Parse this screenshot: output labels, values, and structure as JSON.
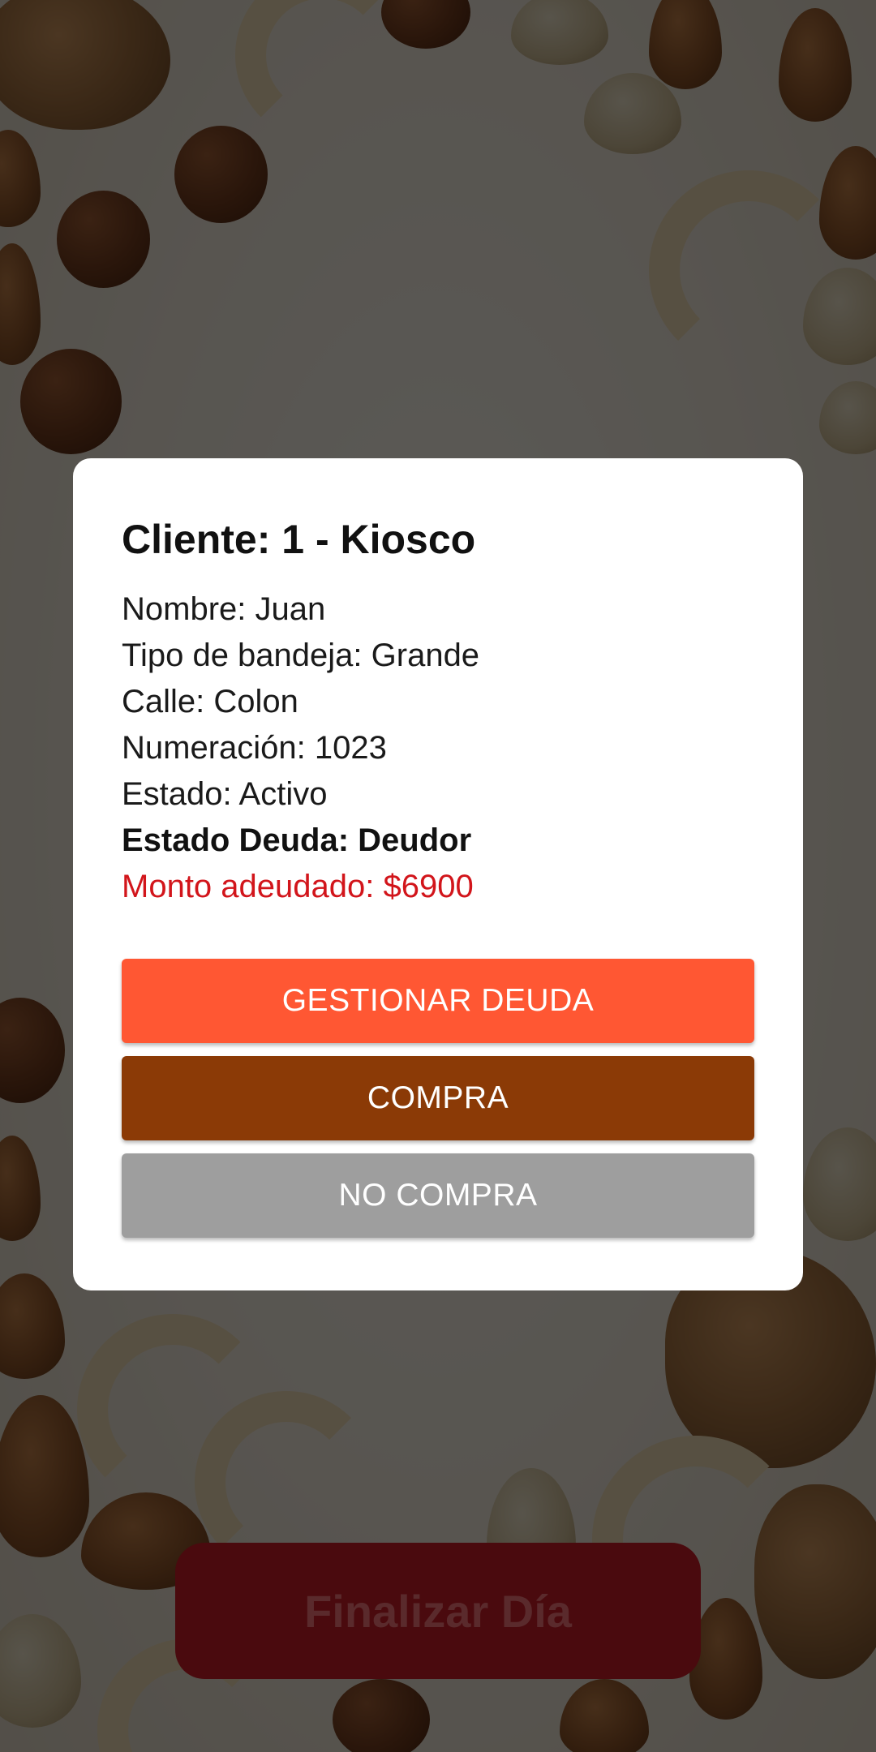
{
  "dialog": {
    "title": "Cliente: 1 - Kiosco",
    "details": [
      {
        "text": "Nombre: Juan"
      },
      {
        "text": "Tipo de bandeja: Grande"
      },
      {
        "text": "Calle: Colon"
      },
      {
        "text": "Numeración: 1023"
      },
      {
        "text": "Estado: Activo"
      },
      {
        "text": "Estado Deuda: Deudor"
      },
      {
        "text": "Monto adeudado: $6900"
      }
    ],
    "buttons": {
      "manage_debt": "GESTIONAR DEUDA",
      "buy": "COMPRA",
      "no_buy": "NO COMPRA"
    }
  },
  "footer": {
    "finish_label": "Finalizar Día"
  },
  "colors": {
    "manage_debt": "#ff5733",
    "buy": "#8b3a06",
    "no_buy": "#9e9e9e",
    "debt_amount_text": "#d2151b",
    "finish_button": "#4a0a0e"
  },
  "background": {
    "image": "mixed-nuts-photo"
  }
}
